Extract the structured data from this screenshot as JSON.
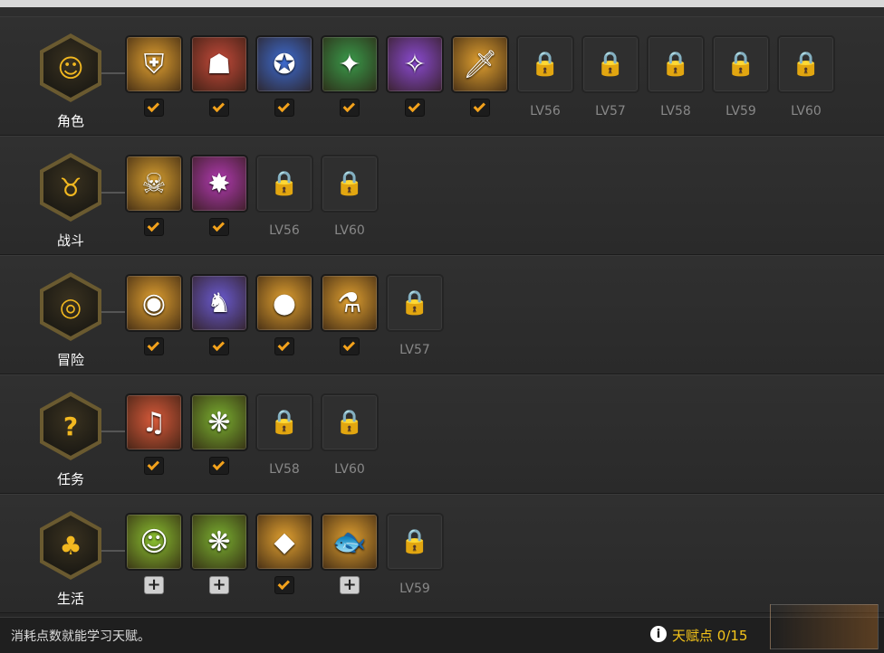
{
  "categories": [
    {
      "label": "角色",
      "icon": "role-face-icon",
      "slots": [
        {
          "state": "learned",
          "icon": "shield-up-icon",
          "bg": "#e0a030",
          "glyph": "⛨"
        },
        {
          "state": "learned",
          "icon": "defense-silhouette-icon",
          "bg": "#c44a3a",
          "glyph": "☗"
        },
        {
          "state": "learned",
          "icon": "pentagram-silhouette-icon",
          "bg": "#3d6bd0",
          "glyph": "✪"
        },
        {
          "state": "learned",
          "icon": "green-ghost-slash-icon",
          "bg": "#3a9a4a",
          "glyph": "✦"
        },
        {
          "state": "learned",
          "icon": "purple-ghost-slash-icon",
          "bg": "#8a4ad0",
          "glyph": "✧"
        },
        {
          "state": "learned",
          "icon": "sword-up-icon",
          "bg": "#e0a030",
          "glyph": "🗡"
        },
        {
          "state": "locked",
          "icon": "lock-icon",
          "level": "LV56"
        },
        {
          "state": "locked",
          "icon": "lock-icon",
          "level": "LV57"
        },
        {
          "state": "locked",
          "icon": "lock-icon",
          "level": "LV58"
        },
        {
          "state": "locked",
          "icon": "lock-icon",
          "level": "LV59"
        },
        {
          "state": "locked",
          "icon": "lock-icon",
          "level": "LV60"
        }
      ]
    },
    {
      "label": "战斗",
      "icon": "battle-demon-icon",
      "slots": [
        {
          "state": "learned",
          "icon": "treasure-chest-skull-icon",
          "bg": "#d8a030",
          "glyph": "☠"
        },
        {
          "state": "learned",
          "icon": "burst-down-icon",
          "bg": "#b03ab0",
          "glyph": "✸"
        },
        {
          "state": "locked",
          "icon": "lock-icon",
          "level": "LV56"
        },
        {
          "state": "locked",
          "icon": "lock-icon",
          "level": "LV60"
        }
      ]
    },
    {
      "label": "冒险",
      "icon": "adventure-compass-icon",
      "slots": [
        {
          "state": "learned",
          "icon": "coin-chest-icon",
          "bg": "#e0a030",
          "glyph": "◉"
        },
        {
          "state": "learned",
          "icon": "cart-icon",
          "bg": "#6a5ad0",
          "glyph": "♞"
        },
        {
          "state": "learned",
          "icon": "orb-chest-icon",
          "bg": "#e0a030",
          "glyph": "●"
        },
        {
          "state": "learned",
          "icon": "potion-down-icon",
          "bg": "#e0a030",
          "glyph": "⚗"
        },
        {
          "state": "locked",
          "icon": "lock-icon",
          "level": "LV57"
        }
      ]
    },
    {
      "label": "任务",
      "icon": "quest-question-icon",
      "slots": [
        {
          "state": "learned",
          "icon": "gift-box-icon",
          "bg": "#d85a3a",
          "glyph": "♫"
        },
        {
          "state": "learned",
          "icon": "green-gem-scroll-icon",
          "bg": "#7ab030",
          "glyph": "❋"
        },
        {
          "state": "locked",
          "icon": "lock-icon",
          "level": "LV58"
        },
        {
          "state": "locked",
          "icon": "lock-icon",
          "level": "LV60"
        }
      ]
    },
    {
      "label": "生活",
      "icon": "life-mushroom-icon",
      "slots": [
        {
          "state": "available",
          "icon": "doll-icon",
          "bg": "#8ac030",
          "glyph": "☺"
        },
        {
          "state": "available",
          "icon": "green-gem-book-icon",
          "bg": "#7ab030",
          "glyph": "❋"
        },
        {
          "state": "learned",
          "icon": "blue-cube-icon",
          "bg": "#e0a030",
          "glyph": "◆"
        },
        {
          "state": "available",
          "icon": "fish-up-icon",
          "bg": "#e0a030",
          "glyph": "🐟"
        },
        {
          "state": "locked",
          "icon": "lock-icon",
          "level": "LV59"
        }
      ]
    }
  ],
  "category_glyphs": [
    "☺",
    "♉",
    "◎",
    "?",
    "♣"
  ],
  "footer": {
    "hint": "消耗点数就能学习天赋。",
    "info_glyph": "i",
    "points": "天赋点 0/15"
  },
  "colors": {
    "check": "#f3a21c",
    "points": "#f6c51a"
  }
}
